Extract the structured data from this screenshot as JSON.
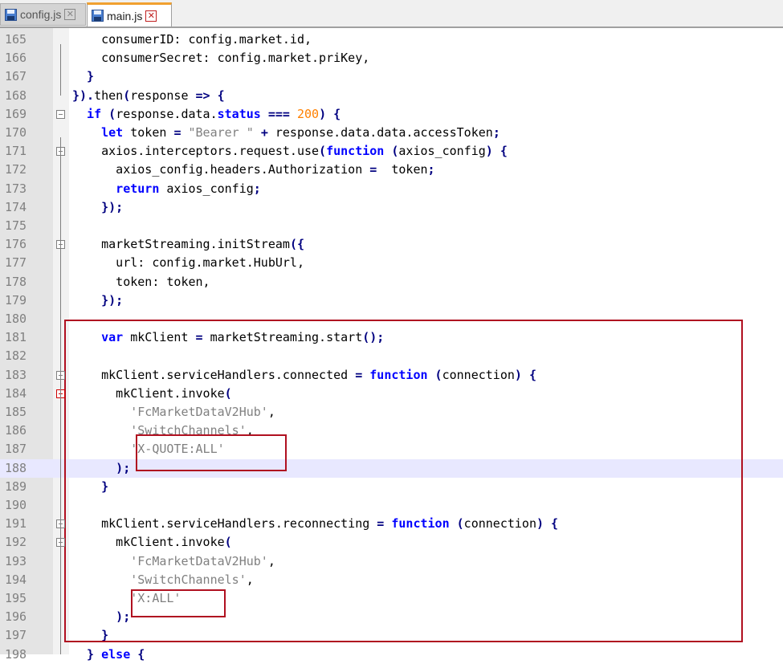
{
  "tabs": [
    {
      "label": "config.js",
      "active": false
    },
    {
      "label": "main.js",
      "active": true
    }
  ],
  "lines": [
    {
      "n": "165",
      "tokens": [
        [
          "txt",
          "    consumerID: config.market.id,"
        ]
      ]
    },
    {
      "n": "166",
      "tokens": [
        [
          "txt",
          "    consumerSecret: config.market.priKey,"
        ]
      ]
    },
    {
      "n": "167",
      "tokens": [
        [
          "sym",
          "  }"
        ]
      ]
    },
    {
      "n": "168",
      "tokens": [
        [
          "sym",
          "})."
        ],
        [
          "txt",
          "then"
        ],
        [
          "sym",
          "("
        ],
        [
          "txt",
          "response "
        ],
        [
          "sym",
          "=> {"
        ]
      ]
    },
    {
      "n": "169",
      "tokens": [
        [
          "kw",
          "  if "
        ],
        [
          "sym",
          "("
        ],
        [
          "txt",
          "response.data."
        ],
        [
          "kw",
          "status "
        ],
        [
          "sym",
          "=== "
        ],
        [
          "num",
          "200"
        ],
        [
          "sym",
          ") {"
        ]
      ]
    },
    {
      "n": "170",
      "tokens": [
        [
          "kw",
          "    let "
        ],
        [
          "txt",
          "token "
        ],
        [
          "sym",
          "= "
        ],
        [
          "str",
          "\"Bearer \" "
        ],
        [
          "sym",
          "+ "
        ],
        [
          "txt",
          "response.data.data.accessToken"
        ],
        [
          "sym",
          ";"
        ]
      ]
    },
    {
      "n": "171",
      "tokens": [
        [
          "txt",
          "    axios.interceptors.request.use"
        ],
        [
          "sym",
          "("
        ],
        [
          "kw",
          "function "
        ],
        [
          "sym",
          "("
        ],
        [
          "txt",
          "axios_config"
        ],
        [
          "sym",
          ") {"
        ]
      ]
    },
    {
      "n": "172",
      "tokens": [
        [
          "txt",
          "      axios_config.headers.Authorization "
        ],
        [
          "sym",
          "=  "
        ],
        [
          "txt",
          "token"
        ],
        [
          "sym",
          ";"
        ]
      ]
    },
    {
      "n": "173",
      "tokens": [
        [
          "kw",
          "      return "
        ],
        [
          "txt",
          "axios_config"
        ],
        [
          "sym",
          ";"
        ]
      ]
    },
    {
      "n": "174",
      "tokens": [
        [
          "sym",
          "    });"
        ]
      ]
    },
    {
      "n": "175",
      "tokens": []
    },
    {
      "n": "176",
      "tokens": [
        [
          "txt",
          "    marketStreaming.initStream"
        ],
        [
          "sym",
          "({"
        ]
      ]
    },
    {
      "n": "177",
      "tokens": [
        [
          "txt",
          "      url: config.market.HubUrl,"
        ]
      ]
    },
    {
      "n": "178",
      "tokens": [
        [
          "txt",
          "      token: token,"
        ]
      ]
    },
    {
      "n": "179",
      "tokens": [
        [
          "sym",
          "    });"
        ]
      ]
    },
    {
      "n": "180",
      "tokens": []
    },
    {
      "n": "181",
      "tokens": [
        [
          "kw",
          "    var "
        ],
        [
          "txt",
          "mkClient "
        ],
        [
          "sym",
          "= "
        ],
        [
          "txt",
          "marketStreaming.start"
        ],
        [
          "sym",
          "();"
        ]
      ]
    },
    {
      "n": "182",
      "tokens": []
    },
    {
      "n": "183",
      "tokens": [
        [
          "txt",
          "    mkClient.serviceHandlers.connected "
        ],
        [
          "sym",
          "= "
        ],
        [
          "kw",
          "function "
        ],
        [
          "sym",
          "("
        ],
        [
          "txt",
          "connection"
        ],
        [
          "sym",
          ") {"
        ]
      ]
    },
    {
      "n": "184",
      "tokens": [
        [
          "txt",
          "      mkClient.invoke"
        ],
        [
          "sym",
          "("
        ]
      ]
    },
    {
      "n": "185",
      "tokens": [
        [
          "str",
          "        'FcMarketDataV2Hub'"
        ],
        [
          "txt",
          ","
        ]
      ]
    },
    {
      "n": "186",
      "tokens": [
        [
          "str",
          "        'SwitchChannels'"
        ],
        [
          "txt",
          ","
        ]
      ]
    },
    {
      "n": "187",
      "tokens": [
        [
          "str",
          "        'X-QUOTE:ALL'"
        ]
      ]
    },
    {
      "n": "188",
      "tokens": [
        [
          "sym",
          "      );"
        ]
      ]
    },
    {
      "n": "189",
      "tokens": [
        [
          "sym",
          "    }"
        ]
      ]
    },
    {
      "n": "190",
      "tokens": []
    },
    {
      "n": "191",
      "tokens": [
        [
          "txt",
          "    mkClient.serviceHandlers.reconnecting "
        ],
        [
          "sym",
          "= "
        ],
        [
          "kw",
          "function "
        ],
        [
          "sym",
          "("
        ],
        [
          "txt",
          "connection"
        ],
        [
          "sym",
          ") {"
        ]
      ]
    },
    {
      "n": "192",
      "tokens": [
        [
          "txt",
          "      mkClient.invoke"
        ],
        [
          "sym",
          "("
        ]
      ]
    },
    {
      "n": "193",
      "tokens": [
        [
          "str",
          "        'FcMarketDataV2Hub'"
        ],
        [
          "txt",
          ","
        ]
      ]
    },
    {
      "n": "194",
      "tokens": [
        [
          "str",
          "        'SwitchChannels'"
        ],
        [
          "txt",
          ","
        ]
      ]
    },
    {
      "n": "195",
      "tokens": [
        [
          "str",
          "        'X:ALL'"
        ]
      ]
    },
    {
      "n": "196",
      "tokens": [
        [
          "sym",
          "      );"
        ]
      ]
    },
    {
      "n": "197",
      "tokens": [
        [
          "sym",
          "    }"
        ]
      ]
    },
    {
      "n": "198",
      "tokens": [
        [
          "sym",
          "  } "
        ],
        [
          "kw",
          "else "
        ],
        [
          "sym",
          "{"
        ]
      ]
    }
  ],
  "highlighted_line": "188",
  "fold_lines": [
    "169",
    "171",
    "176",
    "183",
    "184",
    "191",
    "192"
  ],
  "fold_red": [
    "184"
  ],
  "colors": {
    "annotation": "#b01020",
    "highlight": "#e8e8ff",
    "keyword": "#0000ff",
    "number": "#ff8000"
  }
}
